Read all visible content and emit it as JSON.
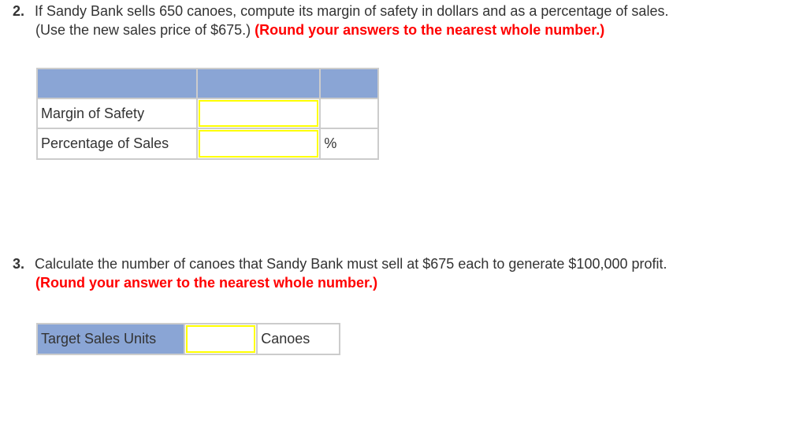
{
  "question2": {
    "number": "2.",
    "line1": "If Sandy Bank sells 650 canoes, compute its margin of safety in dollars and as a percentage of sales.",
    "line2_plain": "(Use the new sales price of $675.) ",
    "line2_instruction": "(Round your answers to the nearest whole number.)",
    "table": {
      "header": [
        "",
        "",
        ""
      ],
      "rows": [
        {
          "label": "Margin of Safety",
          "value": "",
          "unit": ""
        },
        {
          "label": "Percentage of Sales",
          "value": "",
          "unit": "%"
        }
      ]
    }
  },
  "question3": {
    "number": "3.",
    "line1": "Calculate the number of canoes that Sandy Bank must sell at $675 each to generate $100,000 profit.",
    "line2_instruction": "(Round your answer to the nearest whole number.)",
    "table": {
      "label": "Target Sales Units",
      "value": "",
      "unit": "Canoes"
    }
  },
  "colors": {
    "header_fill": "#8aa5d5",
    "input_border": "#ffff00",
    "instruction_red": "#ff0000",
    "grid_border": "#cccccc"
  }
}
